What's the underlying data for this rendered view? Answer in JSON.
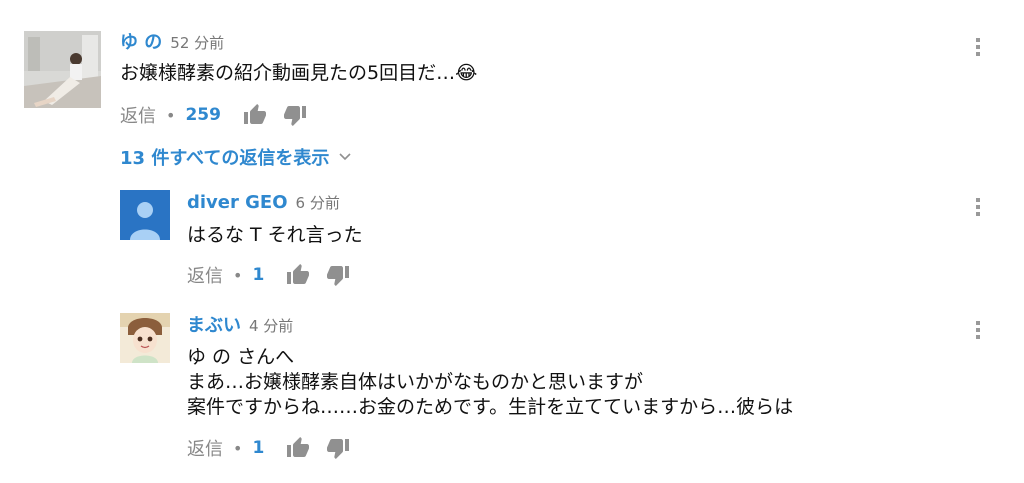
{
  "comments": [
    {
      "author": "ゆ の",
      "time": "52 分前",
      "text": "お嬢様酵素の紹介動画見たの5回目だ…😂",
      "reply_label": "返信",
      "likes": "259",
      "avatar": "photo-avatar"
    }
  ],
  "view_replies_label": "13 件すべての返信を表示",
  "replies": [
    {
      "author": "diver GEO",
      "time": "6 分前",
      "lines": [
        "はるな T それ言った"
      ],
      "reply_label": "返信",
      "likes": "1",
      "avatar": "default-user-avatar"
    },
    {
      "author": "まぶい",
      "time": "4 分前",
      "lines": [
        "ゆ の さんへ",
        "まあ…お嬢様酵素自体はいかがなものかと思いますが",
        "案件ですからね……お金のためです。生計を立てていますから…彼らは"
      ],
      "reply_label": "返信",
      "likes": "1",
      "avatar": "anime-avatar"
    }
  ],
  "colors": {
    "link": "#2f88cf",
    "muted": "#888888",
    "icon": "#909090"
  },
  "icons": [
    "thumb-up-icon",
    "thumb-down-icon",
    "more-vert-icon",
    "chevron-down-icon"
  ]
}
